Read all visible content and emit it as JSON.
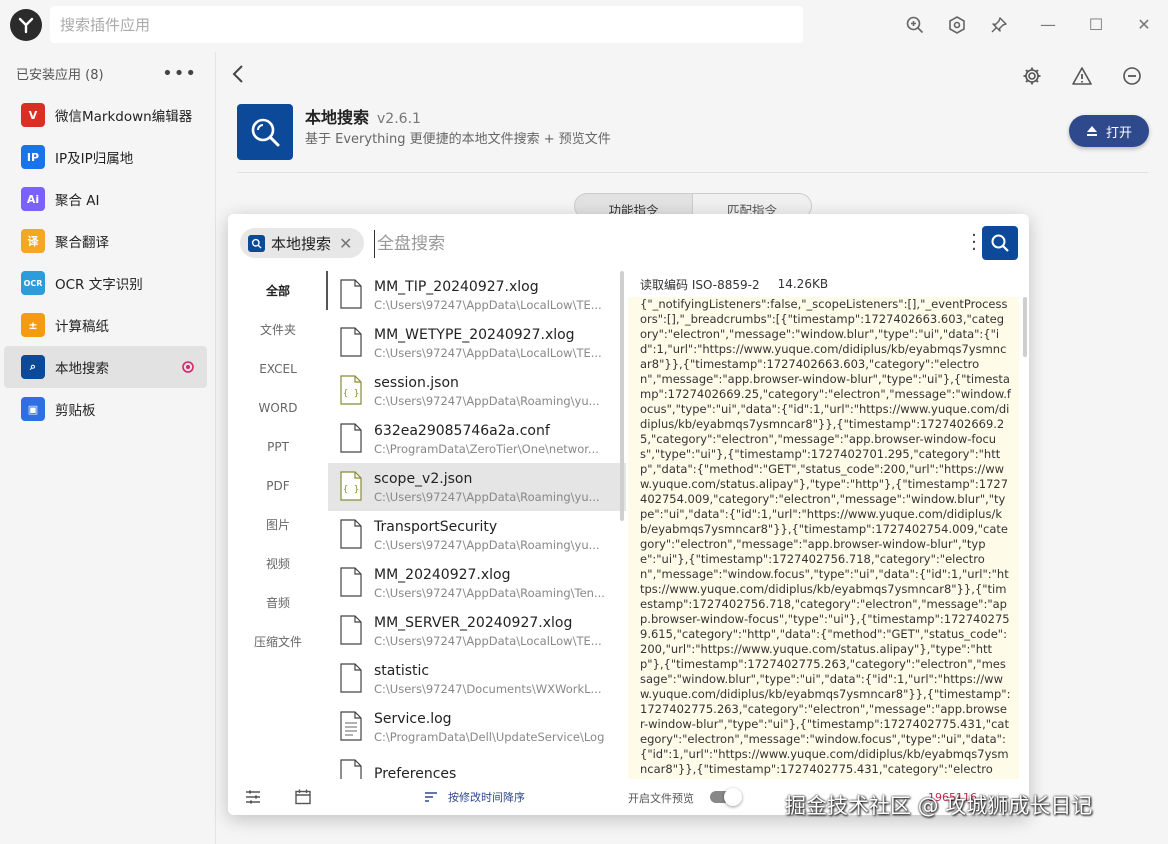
{
  "titlebar": {
    "search_placeholder": "搜索插件应用",
    "icons": [
      "zoom-in-icon",
      "settings-hex-icon",
      "pin-icon"
    ]
  },
  "sidebar": {
    "header": "已安装应用 (8)",
    "more": "•••",
    "items": [
      {
        "label": "微信Markdown编辑器",
        "icon": "wechat-markdown-icon",
        "color": "#d93025"
      },
      {
        "label": "IP及IP归属地",
        "icon": "ip-icon",
        "color": "#1a73e8"
      },
      {
        "label": "聚合 AI",
        "icon": "ai-icon",
        "color": "#7b61ff"
      },
      {
        "label": "聚合翻译",
        "icon": "translate-icon",
        "color": "#f5a623"
      },
      {
        "label": "OCR 文字识别",
        "icon": "ocr-icon",
        "color": "#2d9cdb"
      },
      {
        "label": "计算稿纸",
        "icon": "calculator-icon",
        "color": "#f39c12"
      },
      {
        "label": "本地搜索",
        "icon": "local-search-icon",
        "color": "#0c4a99"
      },
      {
        "label": "剪贴板",
        "icon": "clipboard-icon",
        "color": "#2f6fe4"
      }
    ],
    "active_index": 6
  },
  "main": {
    "app_name": "本地搜索",
    "app_version": "v2.6.1",
    "app_desc": "基于 Everything 更便捷的本地文件搜索 + 预览文件",
    "open_label": "打开",
    "tabs": [
      "功能指令",
      "匹配指令"
    ]
  },
  "preview": {
    "chip_label": "本地搜索",
    "search_placeholder": "全盘搜索",
    "categories": [
      "全部",
      "文件夹",
      "EXCEL",
      "WORD",
      "PPT",
      "PDF",
      "图片",
      "视频",
      "音频",
      "压缩文件"
    ],
    "files": [
      {
        "name": "MM_TIP_20240927.xlog",
        "path": "C:\\Users\\97247\\AppData\\LocalLow\\TE...",
        "type": "file"
      },
      {
        "name": "MM_WETYPE_20240927.xlog",
        "path": "C:\\Users\\97247\\AppData\\LocalLow\\TE...",
        "type": "file"
      },
      {
        "name": "session.json",
        "path": "C:\\Users\\97247\\AppData\\Roaming\\yu...",
        "type": "json"
      },
      {
        "name": "632ea29085746a2a.conf",
        "path": "C:\\ProgramData\\ZeroTier\\One\\networ...",
        "type": "file"
      },
      {
        "name": "scope_v2.json",
        "path": "C:\\Users\\97247\\AppData\\Roaming\\yu...",
        "type": "json"
      },
      {
        "name": "TransportSecurity",
        "path": "C:\\Users\\97247\\AppData\\Roaming\\yu...",
        "type": "file"
      },
      {
        "name": "MM_20240927.xlog",
        "path": "C:\\Users\\97247\\AppData\\Roaming\\Ten...",
        "type": "file"
      },
      {
        "name": "MM_SERVER_20240927.xlog",
        "path": "C:\\Users\\97247\\AppData\\LocalLow\\TE...",
        "type": "file"
      },
      {
        "name": "statistic",
        "path": "C:\\Users\\97247\\Documents\\WXWorkL...",
        "type": "file"
      },
      {
        "name": "Service.log",
        "path": "C:\\ProgramData\\Dell\\UpdateService\\Log",
        "type": "text"
      },
      {
        "name": "Preferences",
        "path": "",
        "type": "file"
      }
    ],
    "selected_index": 4,
    "encoding": "读取编码 ISO-8859-2",
    "size": "14.26KB",
    "content": "{\"_notifyingListeners\":false,\"_scopeListeners\":[],\"_eventProcessors\":[],\"_breadcrumbs\":[{\"timestamp\":1727402663.603,\"category\":\"electron\",\"message\":\"window.blur\",\"type\":\"ui\",\"data\":{\"id\":1,\"url\":\"https://www.yuque.com/didiplus/kb/eyabmqs7ysmncar8\"}},{\"timestamp\":1727402663.603,\"category\":\"electron\",\"message\":\"app.browser-window-blur\",\"type\":\"ui\"},{\"timestamp\":1727402669.25,\"category\":\"electron\",\"message\":\"window.focus\",\"type\":\"ui\",\"data\":{\"id\":1,\"url\":\"https://www.yuque.com/didiplus/kb/eyabmqs7ysmncar8\"}},{\"timestamp\":1727402669.25,\"category\":\"electron\",\"message\":\"app.browser-window-focus\",\"type\":\"ui\"},{\"timestamp\":1727402701.295,\"category\":\"http\",\"data\":{\"method\":\"GET\",\"status_code\":200,\"url\":\"https://www.yuque.com/status.alipay\"},\"type\":\"http\"},{\"timestamp\":1727402754.009,\"category\":\"electron\",\"message\":\"window.blur\",\"type\":\"ui\",\"data\":{\"id\":1,\"url\":\"https://www.yuque.com/didiplus/kb/eyabmqs7ysmncar8\"}},{\"timestamp\":1727402754.009,\"category\":\"electron\",\"message\":\"app.browser-window-blur\",\"type\":\"ui\"},{\"timestamp\":1727402756.718,\"category\":\"electron\",\"message\":\"window.focus\",\"type\":\"ui\",\"data\":{\"id\":1,\"url\":\"https://www.yuque.com/didiplus/kb/eyabmqs7ysmncar8\"}},{\"timestamp\":1727402756.718,\"category\":\"electron\",\"message\":\"app.browser-window-focus\",\"type\":\"ui\"},{\"timestamp\":1727402759.615,\"category\":\"http\",\"data\":{\"method\":\"GET\",\"status_code\":200,\"url\":\"https://www.yuque.com/status.alipay\"},\"type\":\"http\"},{\"timestamp\":1727402775.263,\"category\":\"electron\",\"message\":\"window.blur\",\"type\":\"ui\",\"data\":{\"id\":1,\"url\":\"https://www.yuque.com/didiplus/kb/eyabmqs7ysmncar8\"}},{\"timestamp\":1727402775.263,\"category\":\"electron\",\"message\":\"app.browser-window-blur\",\"type\":\"ui\"},{\"timestamp\":1727402775.431,\"category\":\"electron\",\"message\":\"window.focus\",\"type\":\"ui\",\"data\":{\"id\":1,\"url\":\"https://www.yuque.com/didiplus/kb/eyabmqs7ysmncar8\"}},{\"timestamp\":1727402775.431,\"category\":\"electron\",\"message\":\"app.browser-window-focus\",\"type\":\"u",
    "sort_label": "按修改时间降序",
    "toggle_label": "开启文件预览",
    "count": "1965116"
  },
  "watermark": "掘金技术社区 @ 攻城狮成长日记"
}
